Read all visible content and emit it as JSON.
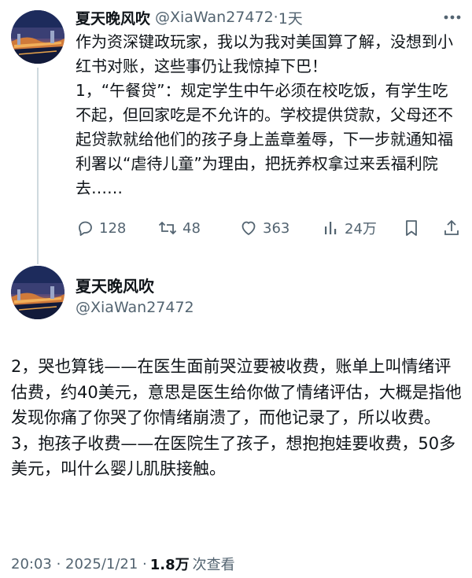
{
  "tweet1": {
    "author_name": "夏天晚风吹",
    "handle": "@XiaWan27472",
    "separator": "·",
    "time_ago": "1天",
    "body": [
      "作为资深键政玩家，我以为我对美国算了解，没想到小红书对账，这些事仍让我惊掉下巴！",
      "1，“午餐贷”：规定学生中午必须在校吃饭，有学生吃不起，但回家吃是不允许的。学校提供贷款，父母还不起贷款就给他们的孩子身上盖章羞辱，下一步就通知福利署以“虐待儿童”为理由，把抚养权拿过来丢福利院去……"
    ],
    "actions": {
      "replies": "128",
      "retweets": "48",
      "likes": "363",
      "views": "24万"
    }
  },
  "tweet2": {
    "author_name": "夏天晚风吹",
    "handle": "@XiaWan27472",
    "body": [
      "2，哭也算钱——在医生面前哭泣要被收费，账单上叫情绪评估费，约40美元，意思是医生给你做了情绪评估，大概是指他发现你痛了你哭了你情绪崩溃了，而他记录了，所以收费。",
      "3，抱孩子收费——在医院生了孩子，想抱抱娃要收费，50多美元，叫什么婴儿肌肤接触。"
    ],
    "timestamp": "20:03 · 2025/1/21 ·",
    "views_count": "1.8万",
    "views_label": "次查看"
  },
  "icons": {
    "more": "more-horizontal-icon",
    "reply": "reply-icon",
    "retweet": "retweet-icon",
    "like": "heart-icon",
    "views": "views-bar-chart-icon",
    "bookmark": "bookmark-icon",
    "share": "share-icon"
  },
  "colors": {
    "text": "#0f1419",
    "secondary": "#536471",
    "thread_line": "#cfd9de"
  }
}
